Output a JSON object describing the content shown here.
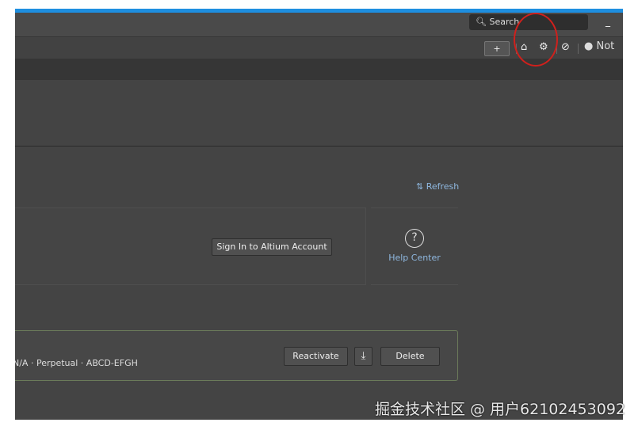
{
  "titlebar": {
    "search_placeholder": "Search",
    "minimize": "_"
  },
  "toolbar": {
    "chat_icon": "+",
    "user_label": "Not"
  },
  "main": {
    "refresh_label": "Refresh",
    "signin_button": "Sign In to Altium Account",
    "help_center": "Help Center",
    "license": {
      "details": "N/A · Perpetual · ABCD-EFGH",
      "reactivate": "Reactivate",
      "delete": "Delete"
    }
  },
  "watermark": "掘金技术社区 @ 用户62102453092"
}
